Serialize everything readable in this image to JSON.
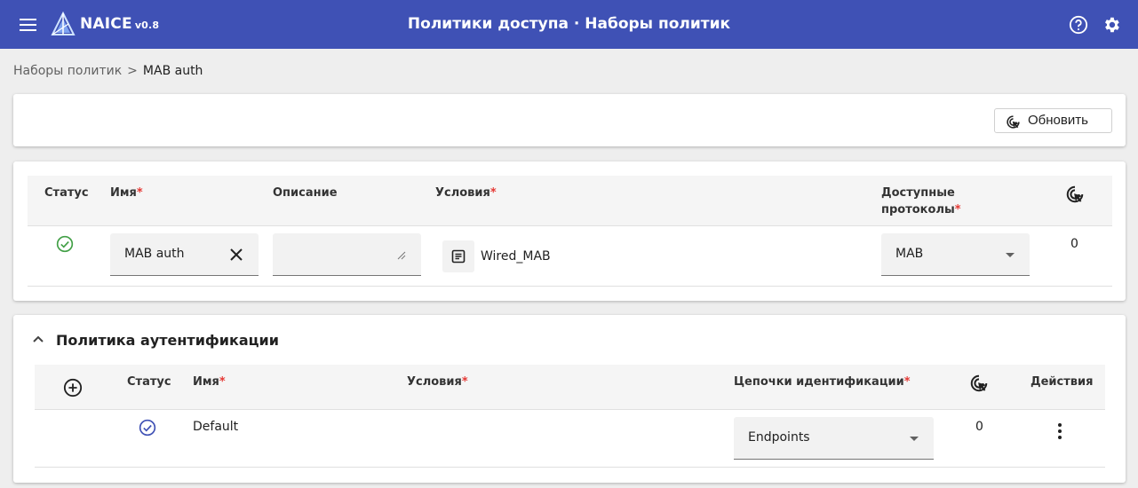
{
  "app": {
    "name": "NAICE",
    "version": "v0.8",
    "title": "Политики доступа · Наборы политик"
  },
  "icons": {
    "menu": "menu-icon",
    "logo": "naice-logo",
    "help": "help-circle-icon",
    "settings": "gear-icon",
    "refresh": "refresh-cursor-icon",
    "hits": "cursor-click-icon",
    "success": "check-circle-icon",
    "add": "plus-circle-icon",
    "more": "more-vertical-icon"
  },
  "colors": {
    "header": "#3f51b5",
    "required": "#e53935",
    "status_green": "#43a047",
    "status_blue": "#3f51b5"
  },
  "breadcrumb": {
    "parent": "Наборы политик",
    "separator": ">",
    "current": "MAB auth"
  },
  "toolbar": {
    "refresh_label": "Обновить"
  },
  "policy_set": {
    "columns": {
      "status": "Статус",
      "name": "Имя",
      "description": "Описание",
      "conditions": "Условия",
      "protocols": "Доступные протоколы",
      "required_mark": "*"
    },
    "row": {
      "name": "MAB auth",
      "description": "",
      "condition": "Wired_MAB",
      "protocol": "MAB",
      "hits": "0"
    }
  },
  "auth_policy": {
    "title": "Политика аутентификации",
    "columns": {
      "status": "Статус",
      "name": "Имя",
      "conditions": "Условия",
      "chains": "Цепочки идентификации",
      "actions": "Действия",
      "required_mark": "*"
    },
    "rows": [
      {
        "name": "Default",
        "chain": "Endpoints",
        "hits": "0"
      }
    ]
  }
}
